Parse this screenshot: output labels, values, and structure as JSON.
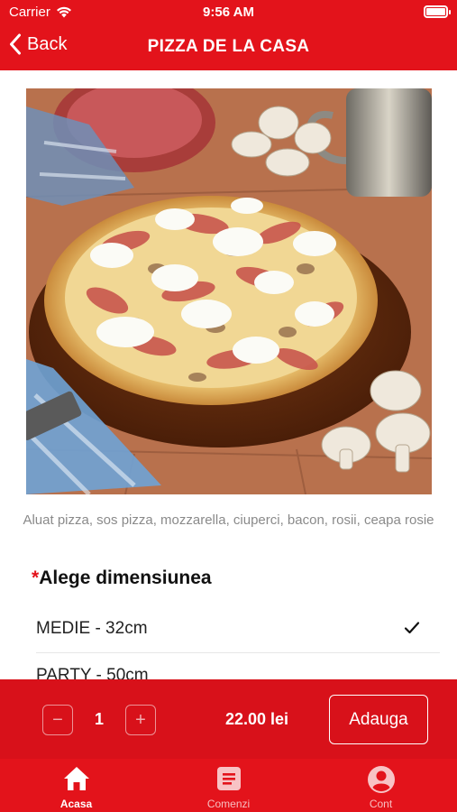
{
  "status_bar": {
    "carrier": "Carrier",
    "time": "9:56 AM"
  },
  "nav": {
    "back_label": "Back",
    "title": "PIZZA DE LA CASA"
  },
  "product": {
    "description": "Aluat pizza, sos pizza, mozzarella, ciuperci, bacon, rosii, ceapa rosie"
  },
  "size_section": {
    "required_mark": "*",
    "title": "Alege dimensiunea",
    "options": [
      {
        "label": "MEDIE - 32cm",
        "selected": true
      },
      {
        "label": "PARTY - 50cm",
        "selected": false
      }
    ]
  },
  "order_bar": {
    "minus": "−",
    "quantity": "1",
    "plus": "+",
    "price": "22.00 lei",
    "add_label": "Adauga"
  },
  "tabs": [
    {
      "label": "Acasa",
      "icon": "home-icon",
      "active": true
    },
    {
      "label": "Comenzi",
      "icon": "list-icon",
      "active": false
    },
    {
      "label": "Cont",
      "icon": "account-icon",
      "active": false
    }
  ],
  "colors": {
    "brand": "#e3131b",
    "description_text": "#8a8a8a"
  }
}
